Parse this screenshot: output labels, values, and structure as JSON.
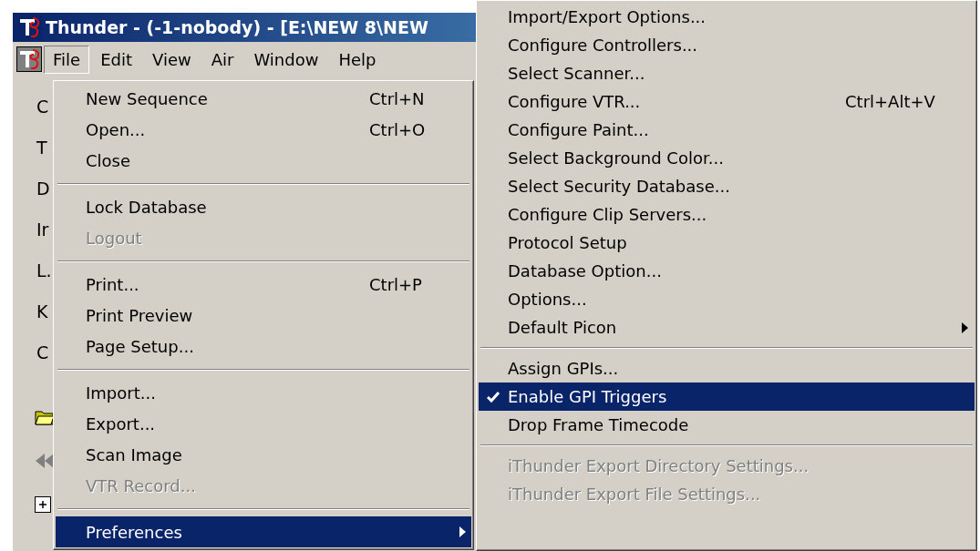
{
  "window": {
    "title": "Thunder - (-1-nobody)  - [E:\\NEW 8\\NEW"
  },
  "menubar": [
    {
      "label": "File",
      "selected": true
    },
    {
      "label": "Edit",
      "selected": false
    },
    {
      "label": "View",
      "selected": false
    },
    {
      "label": "Air",
      "selected": false
    },
    {
      "label": "Window",
      "selected": false
    },
    {
      "label": "Help",
      "selected": false
    }
  ],
  "side_panel": {
    "labels": [
      "C",
      "T",
      "D",
      "Ir",
      "L.",
      "K",
      "C"
    ]
  },
  "file_menu": [
    {
      "kind": "item",
      "label": "New Sequence",
      "shortcut": "Ctrl+N",
      "disabled": false,
      "selected": false
    },
    {
      "kind": "item",
      "label": "Open...",
      "shortcut": "Ctrl+O",
      "disabled": false,
      "selected": false
    },
    {
      "kind": "item",
      "label": "Close",
      "disabled": false,
      "selected": false
    },
    {
      "kind": "separator"
    },
    {
      "kind": "item",
      "label": "Lock Database",
      "disabled": false,
      "selected": false
    },
    {
      "kind": "item",
      "label": "Logout",
      "disabled": true,
      "selected": false
    },
    {
      "kind": "separator"
    },
    {
      "kind": "item",
      "label": "Print...",
      "shortcut": "Ctrl+P",
      "disabled": false,
      "selected": false
    },
    {
      "kind": "item",
      "label": "Print Preview",
      "disabled": false,
      "selected": false
    },
    {
      "kind": "item",
      "label": "Page Setup...",
      "disabled": false,
      "selected": false
    },
    {
      "kind": "separator"
    },
    {
      "kind": "item",
      "label": "Import...",
      "disabled": false,
      "selected": false
    },
    {
      "kind": "item",
      "label": "Export...",
      "disabled": false,
      "selected": false
    },
    {
      "kind": "item",
      "label": "Scan Image",
      "disabled": false,
      "selected": false
    },
    {
      "kind": "item",
      "label": "VTR Record...",
      "disabled": true,
      "selected": false
    },
    {
      "kind": "separator"
    },
    {
      "kind": "submenu",
      "label": "Preferences",
      "disabled": false,
      "selected": true
    }
  ],
  "preferences_menu": [
    {
      "kind": "item",
      "label": "Import/Export Options...",
      "disabled": false,
      "selected": false,
      "checked": false
    },
    {
      "kind": "item",
      "label": "Configure Controllers...",
      "disabled": false,
      "selected": false,
      "checked": false
    },
    {
      "kind": "item",
      "label": "Select Scanner...",
      "disabled": false,
      "selected": false,
      "checked": false
    },
    {
      "kind": "item",
      "label": "Configure VTR...",
      "shortcut": "Ctrl+Alt+V",
      "disabled": false,
      "selected": false,
      "checked": false
    },
    {
      "kind": "item",
      "label": "Configure Paint...",
      "disabled": false,
      "selected": false,
      "checked": false
    },
    {
      "kind": "item",
      "label": "Select Background Color...",
      "disabled": false,
      "selected": false,
      "checked": false
    },
    {
      "kind": "item",
      "label": "Select Security Database...",
      "disabled": false,
      "selected": false,
      "checked": false
    },
    {
      "kind": "item",
      "label": "Configure Clip Servers...",
      "disabled": false,
      "selected": false,
      "checked": false
    },
    {
      "kind": "item",
      "label": "Protocol Setup",
      "disabled": false,
      "selected": false,
      "checked": false
    },
    {
      "kind": "item",
      "label": "Database Option...",
      "disabled": false,
      "selected": false,
      "checked": false
    },
    {
      "kind": "item",
      "label": "Options...",
      "disabled": false,
      "selected": false,
      "checked": false
    },
    {
      "kind": "submenu",
      "label": "Default Picon",
      "disabled": false,
      "selected": false,
      "checked": false
    },
    {
      "kind": "separator"
    },
    {
      "kind": "item",
      "label": "Assign GPIs...",
      "disabled": false,
      "selected": false,
      "checked": false
    },
    {
      "kind": "item",
      "label": "Enable GPI Triggers",
      "disabled": false,
      "selected": true,
      "checked": true
    },
    {
      "kind": "item",
      "label": "Drop Frame Timecode",
      "disabled": false,
      "selected": false,
      "checked": false
    },
    {
      "kind": "separator"
    },
    {
      "kind": "item",
      "label": "iThunder Export Directory Settings...",
      "disabled": true,
      "selected": false,
      "checked": false
    },
    {
      "kind": "item",
      "label": "iThunder Export File Settings...",
      "disabled": true,
      "selected": false,
      "checked": false
    }
  ]
}
